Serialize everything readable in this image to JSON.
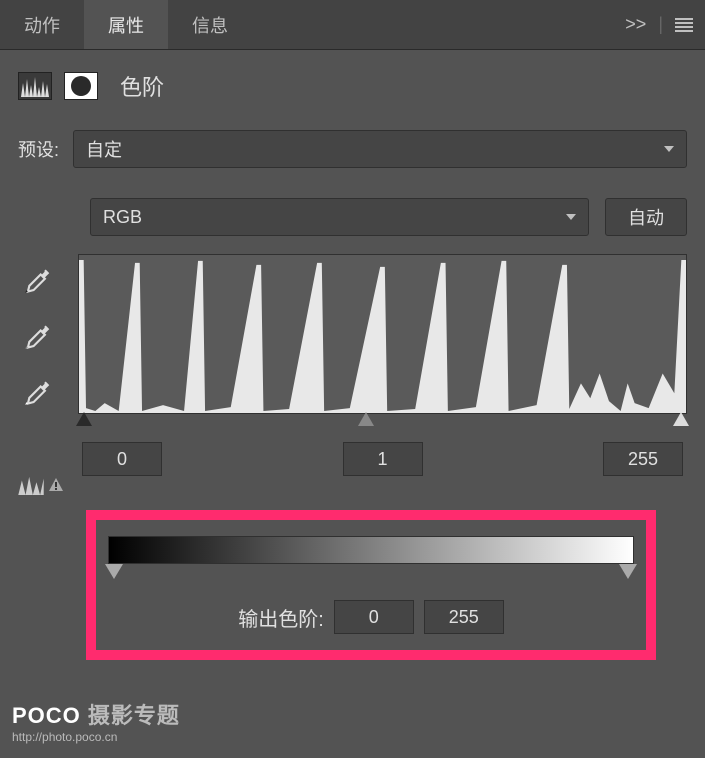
{
  "tabs": {
    "actions": "动作",
    "properties": "属性",
    "info": "信息"
  },
  "panel": {
    "title": "色阶"
  },
  "preset": {
    "label": "预设:",
    "value": "自定"
  },
  "channel": {
    "value": "RGB",
    "auto": "自动"
  },
  "input_levels": {
    "black": "0",
    "gamma": "1",
    "white": "255"
  },
  "output": {
    "label": "输出色阶:",
    "black": "0",
    "white": "255"
  },
  "watermark": {
    "brand_bold": "POCO",
    "brand_rest": " 摄影专题",
    "url": "http://photo.poco.cn"
  }
}
